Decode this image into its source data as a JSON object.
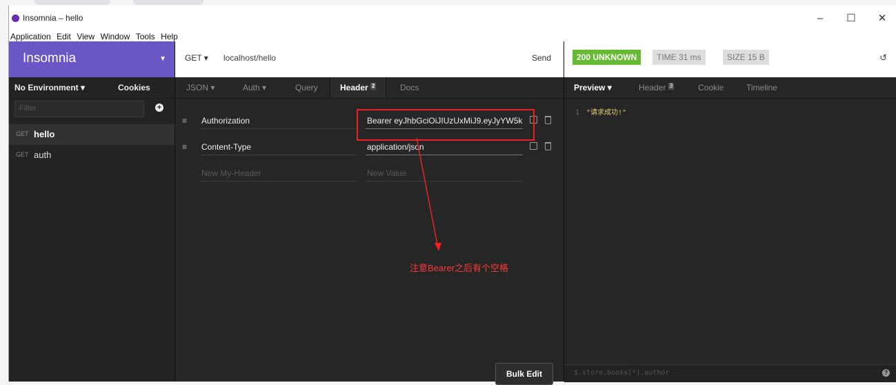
{
  "window": {
    "title": "Insomnia – hello",
    "controls": {
      "minimize": "–",
      "maximize": "☐",
      "close": "✕"
    }
  },
  "menu": [
    "Application",
    "Edit",
    "View",
    "Window",
    "Tools",
    "Help"
  ],
  "sidebar": {
    "app_name": "Insomnia",
    "environment": "No Environment ▾",
    "cookies": "Cookies",
    "filter_placeholder": "Filter",
    "add_icon": "+",
    "requests": [
      {
        "method": "GET",
        "name": "hello",
        "active": true
      },
      {
        "method": "GET",
        "name": "auth",
        "active": false
      }
    ]
  },
  "request": {
    "method": "GET ▾",
    "url": "localhost/hello",
    "send_label": "Send",
    "tabs": {
      "json": "JSON ▾",
      "auth": "Auth ▾",
      "query": "Query",
      "header": "Header",
      "header_count": "2",
      "docs": "Docs"
    },
    "headers": [
      {
        "name": "Authorization",
        "value": "Bearer eyJhbGciOiJIUzUxMiJ9.eyJyYW5k"
      },
      {
        "name": "Content-Type",
        "value": "application/json"
      }
    ],
    "new_header_placeholder": "New My-Header",
    "new_value_placeholder": "New Value",
    "bulk_edit_label": "Bulk Edit",
    "annotation": "注意Bearer之后有个空格"
  },
  "response": {
    "status": "200 UNKNOWN",
    "time": "TIME 31 ms",
    "size": "SIZE 15 B",
    "tabs": {
      "preview": "Preview ▾",
      "header": "Header",
      "header_count": "3",
      "cookie": "Cookie",
      "timeline": "Timeline"
    },
    "body_line_number": "1",
    "body": "\"请求成功!\"",
    "filter_placeholder": "$.store.books[*].author",
    "help_icon": "?"
  },
  "colors": {
    "sidebar_header": "#6b56c5",
    "status_ok": "#66bb33",
    "annotation": "#ee2222"
  },
  "icons": {
    "app": "insomnia-logo-icon",
    "drag": "drag-handle-icon",
    "checkbox": "checkbox-icon",
    "trash": "trash-icon",
    "history": "history-icon"
  }
}
